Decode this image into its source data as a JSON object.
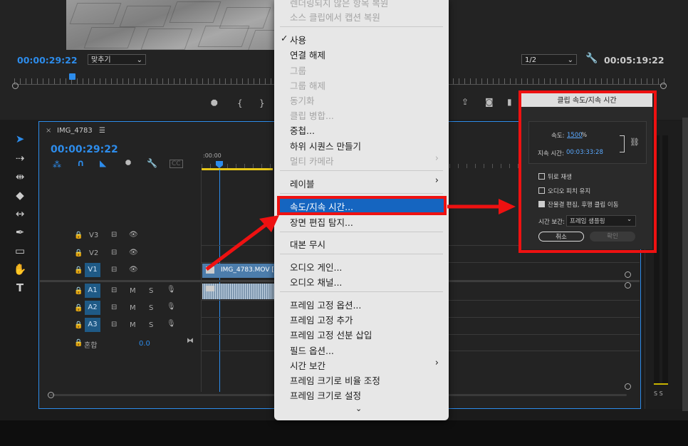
{
  "monitor": {
    "timecode_current": "00:00:29:22",
    "fit_dropdown": "맞추기",
    "resolution_dropdown": "1/2",
    "timecode_duration": "00:05:19:22"
  },
  "sequence": {
    "name": "IMG_4783",
    "timecode": "00:00:29:22",
    "ruler_start": ":00:00",
    "clip_name": "IMG_4783.MOV [",
    "mix_label": "혼합",
    "mix_value": "0.0"
  },
  "tracks": {
    "video": [
      "V3",
      "V2",
      "V1"
    ],
    "audio": [
      "A1",
      "A2",
      "A3"
    ],
    "mute_label": "M",
    "solo_label": "S"
  },
  "context_menu": {
    "items_top": [
      "렌더링되지 않은 항목 복원",
      "소스 클립에서 캡션 복원"
    ],
    "enable": "사용",
    "unlink": "연결 해제",
    "group": "그룹",
    "ungroup": "그룹 해제",
    "synchronize": "동기화",
    "merge_clips": "클립 병합...",
    "nest": "중첩...",
    "make_subsequence": "하위 시퀀스 만들기",
    "multicam": "멀티 카메라",
    "label": "레이블",
    "speed_duration": "속도/지속 시간...",
    "scene_edit_detection": "장면 편집 탐지...",
    "ignore_script": "대본 무시",
    "audio_gain": "오디오 게인...",
    "audio_channels": "오디오 채널...",
    "frame_hold_options": "프레임 고정 옵션...",
    "add_frame_hold": "프레임 고정 추가",
    "insert_frame_hold_segment": "프레임 고정 선분 삽입",
    "field_options": "필드 옵션...",
    "time_interpolation": "시간 보간",
    "scale_to_frame_size": "프레임 크기로 비율 조정",
    "set_to_frame_size": "프레임 크기로 설정"
  },
  "dialog": {
    "title": "클립 속도/지속 시간",
    "speed_label": "속도:",
    "speed_value": "1500",
    "speed_unit": "%",
    "duration_label": "지속 시간:",
    "duration_value": "00:03:33:28",
    "reverse_speed": "뒤로 재생",
    "maintain_pitch": "오디오 피치 유지",
    "ripple_edit": "잔물결 편집, 후행 클립 이동",
    "time_interp_label": "시간 보간:",
    "time_interp_value": "프레임 샘플링",
    "cancel": "취소",
    "ok": "확인"
  },
  "colors": {
    "accent": "#2d8ceb",
    "highlight": "#1565c0",
    "annotation": "#ee1111"
  }
}
